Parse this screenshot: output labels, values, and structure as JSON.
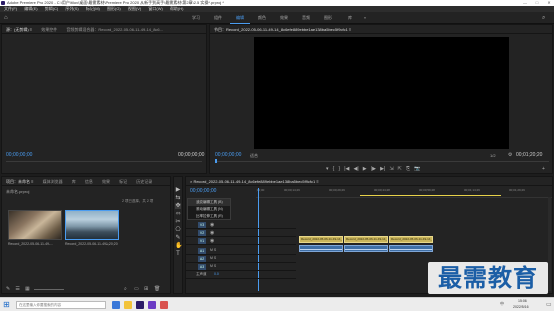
{
  "window": {
    "title": "Adobe Premiere Pro 2020 - C:\\用户\\tilov\\桌面\\最需素材\\Premiere Pro 2020 从新手到高手\\最需素材\\第2章\\2.5 实操*.prproj *",
    "minimize": "—",
    "maximize": "□",
    "close": "✕"
  },
  "menubar": [
    "文件(F)",
    "编辑(E)",
    "剪辑(C)",
    "序列(S)",
    "标记(M)",
    "图形(G)",
    "视图(V)",
    "窗口(W)",
    "帮助(H)"
  ],
  "workspaces": {
    "items": [
      "学习",
      "组件",
      "编辑",
      "颜色",
      "效果",
      "音频",
      "图形",
      "库"
    ],
    "active_index": 2,
    "more": "»"
  },
  "source_panel": {
    "tabs": [
      "源：(无剪辑) ≡",
      "效果控件",
      "音频剪辑混合器：Record_2022-05-06-11-49-14_8c6..."
    ],
    "timecode_left": "00;00;00;00",
    "timecode_right": "00;00;00;00"
  },
  "program_panel": {
    "tab_title": "节目：Record_2022-05-06-11-49-14_8c6efe889ebbe1ae138ba5bec5f9cfc1 ≡",
    "timecode": "00;00;00;00",
    "fit": "适合",
    "quality": "1/2",
    "duration": "00;01;20;20",
    "controls": [
      "▾",
      "{",
      "}",
      "|◀",
      "◀|",
      "▶",
      "|▶",
      "▶|",
      "⇲",
      "⇱",
      "⎘",
      "📷",
      "+"
    ]
  },
  "project_panel": {
    "tabs": [
      "项目：未命名 ≡",
      "媒体浏览器",
      "库",
      "信息",
      "效果",
      "标记",
      "历史记录"
    ],
    "path": "未命名.prproj",
    "count": "2 项已选择，共 2 项",
    "clips": [
      {
        "name": "Record_2022-05-06-11-49-...",
        "duration": "1;20;20"
      },
      {
        "name": "Record_2022-05-06-11-49-...",
        "duration": "1;20;20"
      }
    ]
  },
  "tools": [
    "▶",
    "⇆",
    "✥",
    "⬄",
    "✂",
    "⎔",
    "✎",
    "✋",
    "T"
  ],
  "context_menu": {
    "items": [
      "波纹编辑工具 (B)",
      "滚动编辑工具 (N)",
      "比率拉伸工具 (R)"
    ],
    "selected_index": 0
  },
  "timeline": {
    "tab_title": "× Record_2022-05-06-11-49-14_8c6efe889ebbe1ae138ba5bec5f9cfc1 ≡",
    "timecode": "00;00;00;00",
    "ruler": [
      ";00;00",
      "00;00;14;29",
      "00;00;29;29",
      "00;00;44;28",
      "00;00;59;28",
      "00;01;14;29",
      "00;01;29;29"
    ],
    "video_tracks": [
      "V3",
      "V2",
      "V1"
    ],
    "audio_tracks": [
      "A1",
      "A2",
      "A3"
    ],
    "master": "主声道",
    "master_value": "0.0",
    "clips_v": [
      "Record_2022-05-06-11-49-14_8c6efe88",
      "Record_2022-05-06-11-49-14_8c6efe88",
      "Record_2022-05-06-11-49-14_8c6efe88"
    ]
  },
  "watermark": "最需教育",
  "taskbar": {
    "time": "15:06",
    "date": "2022/5/16",
    "lang": "中",
    "search_placeholder": "在这里输入你要搜索的内容"
  },
  "colors": {
    "accent": "#4a9cf0",
    "video_clip": "#c9b45a",
    "audio_clip": "#3f6fa6",
    "watermark": "#1b5ea6"
  }
}
